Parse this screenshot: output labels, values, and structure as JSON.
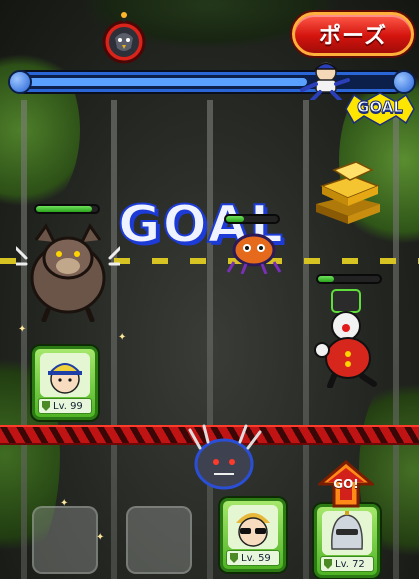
{
  "hud": {
    "pause_label": "ポーズ",
    "goal_badge_label": "GOAL",
    "progress": 0.76
  },
  "field": {
    "goal_banner_text": "GOAL",
    "go_button_label": "GO!"
  },
  "enemies": [
    {
      "name": "werewolf",
      "hp": 0.9
    },
    {
      "name": "orange-crab-monster",
      "hp": 0.35
    },
    {
      "name": "clown-robot",
      "hp": 0.25
    },
    {
      "name": "dark-clawed-beast"
    }
  ],
  "units": [
    {
      "name": "baseball-player",
      "level": "Lv. 99"
    },
    {
      "name": "sunglasses-player",
      "level": "Lv. 59"
    },
    {
      "name": "armored-knight",
      "level": "Lv. 72"
    }
  ],
  "colors": {
    "hp_green": "#2aa41c",
    "progress_blue": "#2b66d6",
    "pause_red": "#d4140e",
    "card_green": "#4fb424",
    "tape_red": "#c01414"
  }
}
